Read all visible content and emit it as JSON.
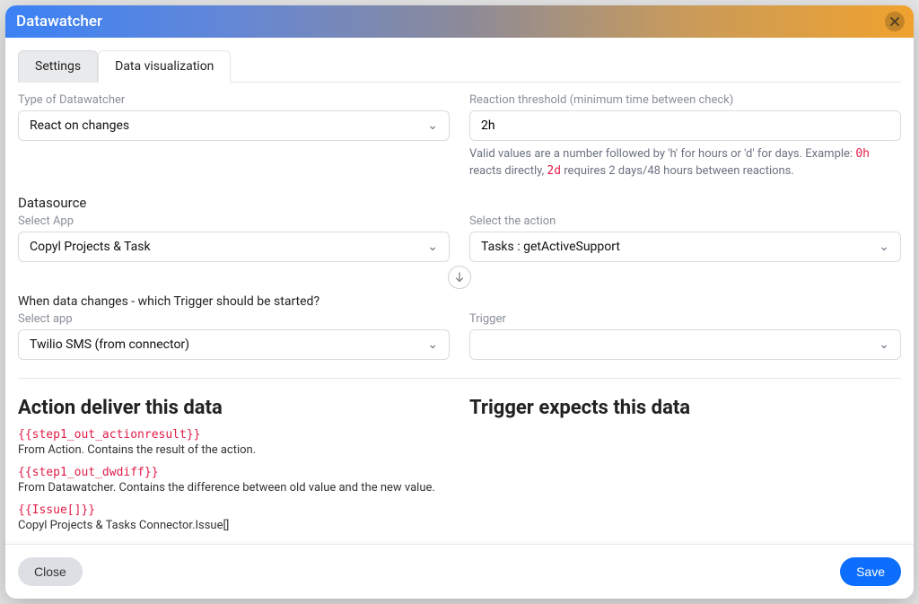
{
  "modal": {
    "title": "Datawatcher"
  },
  "tabs": {
    "settings": "Settings",
    "dataviz": "Data visualization"
  },
  "fields": {
    "type_label": "Type of Datawatcher",
    "type_value": "React on changes",
    "threshold_label": "Reaction threshold (minimum time between check)",
    "threshold_value": "2h",
    "threshold_help_pre": "Valid values are a number followed by 'h' for hours or 'd' for days. Example: ",
    "threshold_help_code1": "0h",
    "threshold_help_mid": " reacts directly, ",
    "threshold_help_code2": "2d",
    "threshold_help_post": " requires 2 days/48 hours between reactions.",
    "datasource_title": "Datasource",
    "select_app_label": "Select App",
    "select_app_value": "Copyl Projects & Task",
    "select_action_label": "Select the action",
    "select_action_value": "Tasks : getActiveSupport",
    "when_text": "When data changes - which Trigger should be started?",
    "trigger_app_label": "Select app",
    "trigger_app_value": "Twilio SMS (from connector)",
    "trigger_label": "Trigger",
    "trigger_value": ""
  },
  "action_deliver": {
    "heading": "Action deliver this data",
    "items": [
      {
        "token": "{{step1_out_actionresult}}",
        "desc": "From Action. Contains the result of the action."
      },
      {
        "token": "{{step1_out_dwdiff}}",
        "desc": "From Datawatcher. Contains the difference between old value and the new value."
      },
      {
        "token": "{{Issue[]}}",
        "desc": "Copyl Projects & Tasks Connector.Issue[]"
      }
    ]
  },
  "trigger_expects": {
    "heading": "Trigger expects this data"
  },
  "footer": {
    "close": "Close",
    "save": "Save"
  }
}
